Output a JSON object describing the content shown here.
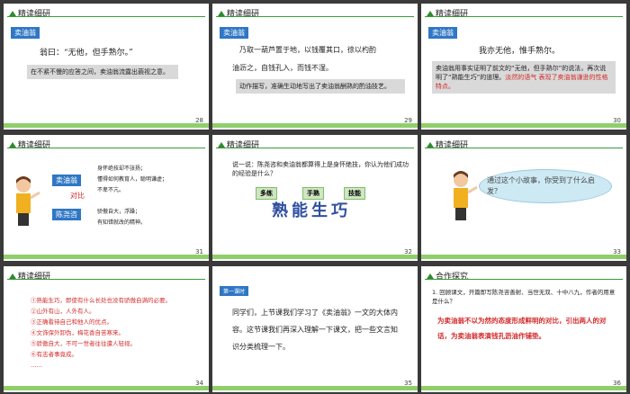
{
  "header": "精读细研",
  "header_pa": "合作探究",
  "slides": [
    {
      "num": "28",
      "tab": "卖油翁",
      "text": "翁曰：“无他，但手熟尔。”",
      "gray": "在不紧不慢的应答之间，卖油翁流露出藐视之意。"
    },
    {
      "num": "29",
      "tab": "卖油翁",
      "lines": [
        "乃取一葫芦置于地，以钱覆其口，徐以杓酌",
        "油沥之，自钱孔入，而钱不湿。"
      ],
      "gray": "动作描写，准确生动地写出了卖油翁酬熟的酌油技艺。",
      "gray_red": "动作描写，"
    },
    {
      "num": "30",
      "tab": "卖油翁",
      "text": "我亦无他，惟手熟尔。",
      "gray": "卖油翁用事实证明了前文的“无他，但手熟尔”的说法，再次说明了“熟能生巧”的道理。",
      "gray_red": "淡然的语气 表现了卖油翁谦逊的性格特点。"
    },
    {
      "num": "31",
      "names": [
        "卖油翁",
        "对比",
        "陈尧咨"
      ],
      "right": [
        "身怀绝技却不张扬；",
        "懂得如何教育人，聪明谦虚；",
        "不卑不亢。",
        "骄傲自大，浮躁；",
        "有知错就改的精神。"
      ]
    },
    {
      "num": "32",
      "question": "说一说：陈尧咨和卖油翁都算得上是身怀绝技，你认为他们成功的经验是什么？",
      "q_prefix": "说一说：",
      "keywords": [
        "多练",
        "手熟",
        "技能"
      ],
      "big": "熟能生巧"
    },
    {
      "num": "33",
      "bubble": "通过这个小故事，你受到了什么启发？"
    },
    {
      "num": "34",
      "items": [
        "①熟能生巧，即使有什么长处也没有骄傲自满的必要。",
        "②山外有山，人外有人。",
        "③正确看待自己和他人的优点。",
        "④文饰保外卸伪，梅花香自苦寒来。",
        "⑤骄傲自大，不可一世者往往遭人轻视。",
        "⑥有志者事竟成。",
        "……"
      ]
    },
    {
      "num": "35",
      "tab": "第一课时",
      "text": "同学们，上节课我们学习了《卖油翁》一文的大体内容。这节课我们再深入理解一下课文，把一些文言知识分类梳理一下。"
    },
    {
      "num": "36",
      "question": "1. 回顾课文，开篇即写陈尧咨善射、当世无双、十中八九，作者的用意是什么？",
      "answer": "为卖油翁不以为然的态度形成鲜明的对比，引出两人的对话，为卖油翁表演钱孔沥油作铺垫。"
    }
  ],
  "colors": {
    "accent": "#2f77c5",
    "red": "#d42a2a",
    "green": "#8fcf6a"
  }
}
